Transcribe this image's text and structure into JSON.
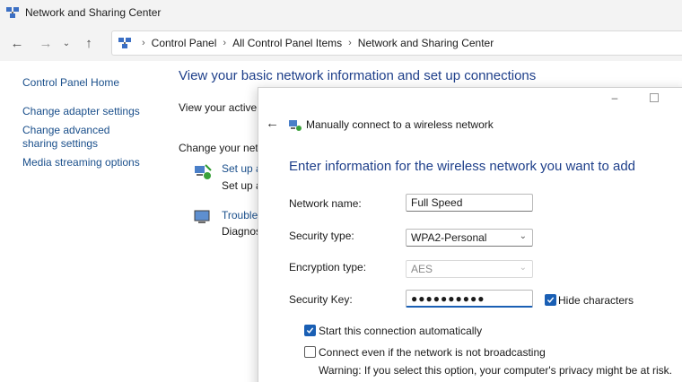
{
  "window": {
    "title": "Network and Sharing Center"
  },
  "nav": {
    "back_icon": "arrow-left-icon",
    "forward_icon": "arrow-right-icon",
    "recent_icon": "chevron-down-icon",
    "up_icon": "arrow-up-icon"
  },
  "breadcrumb": [
    "Control Panel",
    "All Control Panel Items",
    "Network and Sharing Center"
  ],
  "sidebar": {
    "items": [
      {
        "label": "Control Panel Home"
      },
      {
        "label": "Change adapter settings"
      },
      {
        "label": "Change advanced sharing settings"
      },
      {
        "label": "Media streaming options"
      }
    ]
  },
  "main": {
    "heading": "View your basic network information and set up connections",
    "active_networks_text": "View your active net",
    "change_settings_text": "Change your netwo",
    "setup_link": "Set up a",
    "setup_desc": "Set up a",
    "troubleshoot_link": "Troubles",
    "troubleshoot_desc": "Diagnose"
  },
  "dialog": {
    "title": "Manually connect to a wireless network",
    "heading": "Enter information for the wireless network you want to add",
    "network_name_label": "Network name:",
    "network_name_value": "Full Speed",
    "security_type_label": "Security type:",
    "security_type_value": "WPA2-Personal",
    "encryption_type_label": "Encryption type:",
    "encryption_type_value": "AES",
    "security_key_label": "Security Key:",
    "security_key_masked": "●●●●●●●●●●",
    "hide_characters_label": "Hide characters",
    "hide_characters_checked": true,
    "start_auto_label": "Start this connection automatically",
    "start_auto_checked": true,
    "connect_even_label": "Connect even if the network is not broadcasting",
    "connect_even_checked": false,
    "warning_text": "Warning: If you select this option, your computer's privacy might be at risk."
  },
  "colors": {
    "accent": "#1a5fb4",
    "link": "#1a4f8b",
    "heading": "#1e3f8a"
  }
}
